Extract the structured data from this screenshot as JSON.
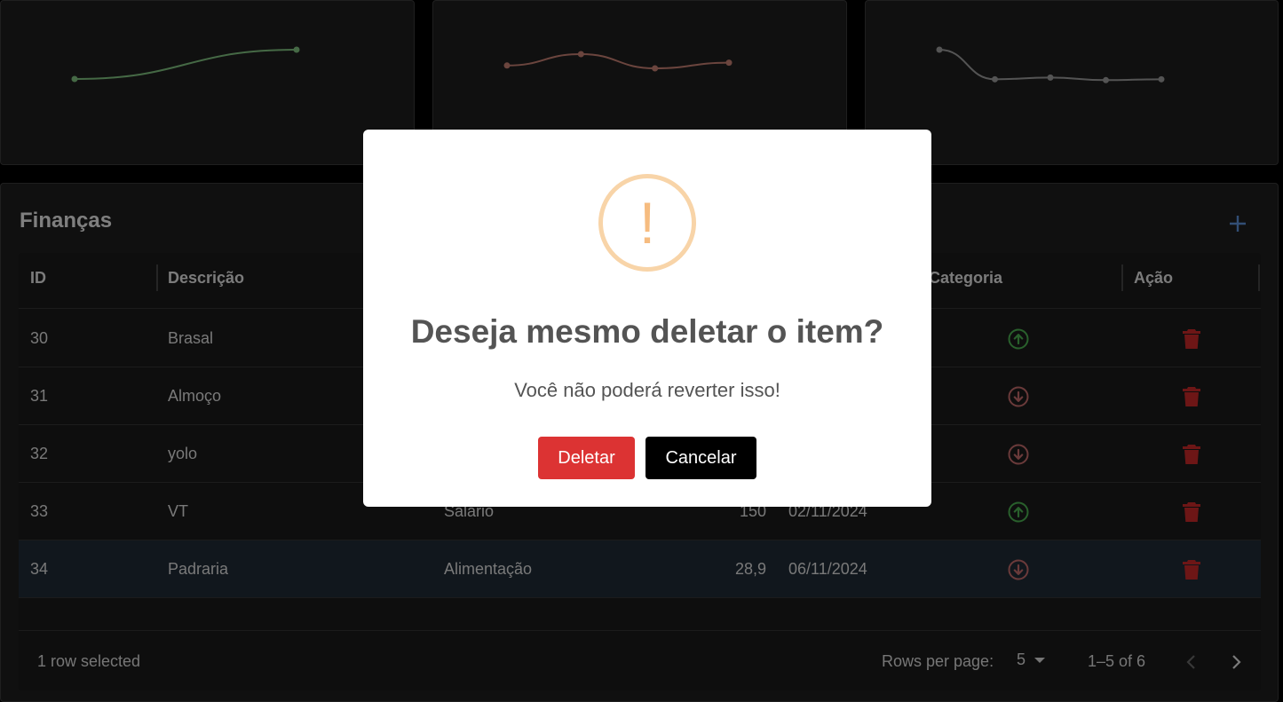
{
  "charts": [
    {
      "color": "#7fbf7f",
      "points": [
        0.0,
        1.0
      ]
    },
    {
      "color": "#c47e72",
      "points": [
        0.6,
        1.0,
        0.5,
        0.7
      ]
    },
    {
      "color": "#9a9a9a",
      "points": [
        1.0,
        0.32,
        0.36,
        0.3,
        0.32
      ]
    }
  ],
  "finance": {
    "title": "Finanças",
    "columns": {
      "id": "ID",
      "description": "Descrição",
      "category": "Categoria",
      "action": "Ação"
    },
    "rows": [
      {
        "id": "30",
        "description": "Brasal",
        "category": "",
        "value": "",
        "date": "",
        "type": "income"
      },
      {
        "id": "31",
        "description": "Almoço",
        "category": "",
        "value": "",
        "date": "",
        "type": "expense"
      },
      {
        "id": "32",
        "description": "yolo",
        "category": "",
        "value": "",
        "date": "",
        "type": "expense"
      },
      {
        "id": "33",
        "description": "VT",
        "category": "Salário",
        "value": "150",
        "date": "02/11/2024",
        "type": "income"
      },
      {
        "id": "34",
        "description": "Padraria",
        "category": "Alimentação",
        "value": "28,9",
        "date": "06/11/2024",
        "type": "expense"
      }
    ],
    "footer": {
      "selected_text": "1 row selected",
      "rows_per_page_label": "Rows per page:",
      "rows_per_page_value": "5",
      "pagination_text": "1–5 of 6"
    }
  },
  "modal": {
    "icon": "!",
    "title": "Deseja mesmo deletar o item?",
    "text": "Você não poderá reverter isso!",
    "delete_label": "Deletar",
    "cancel_label": "Cancelar"
  },
  "colors": {
    "income": "#4caf50",
    "expense": "#c26b6b",
    "delete": "#c62828",
    "accent": "#5b8fd6"
  }
}
